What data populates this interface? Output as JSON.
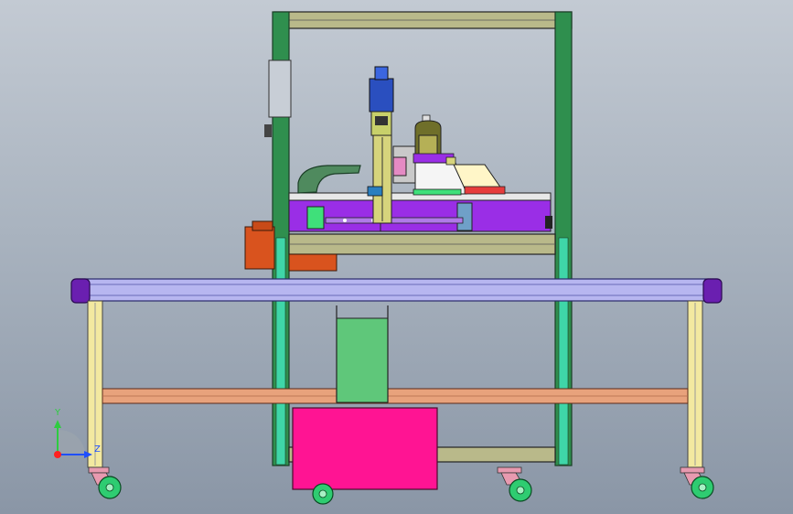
{
  "viewport": {
    "background_top": "#c3cad3",
    "background_bottom": "#8a96a6"
  },
  "colors": {
    "frame_green": "#2f8f4e",
    "frame_teal": "#3fd6a8",
    "beam_olive": "#b9b98a",
    "conveyor_purple": "#6a1fb0",
    "conveyor_lavender": "#b7b6f0",
    "rail_salmon": "#e8a27c",
    "tank_pink": "#ff1493",
    "bin_green": "#5fc77a",
    "motor_orange": "#d9531e",
    "plate_purple": "#9a2ee6",
    "caster_green": "#2ecc71",
    "caster_pink": "#e89ab0",
    "leg_yellow": "#f3e9a0",
    "axis_y": "#2ecc40",
    "axis_z": "#1f4fff",
    "axis_x": "#ff2020"
  },
  "triad": {
    "y_label": "Y",
    "z_label": "Z"
  }
}
